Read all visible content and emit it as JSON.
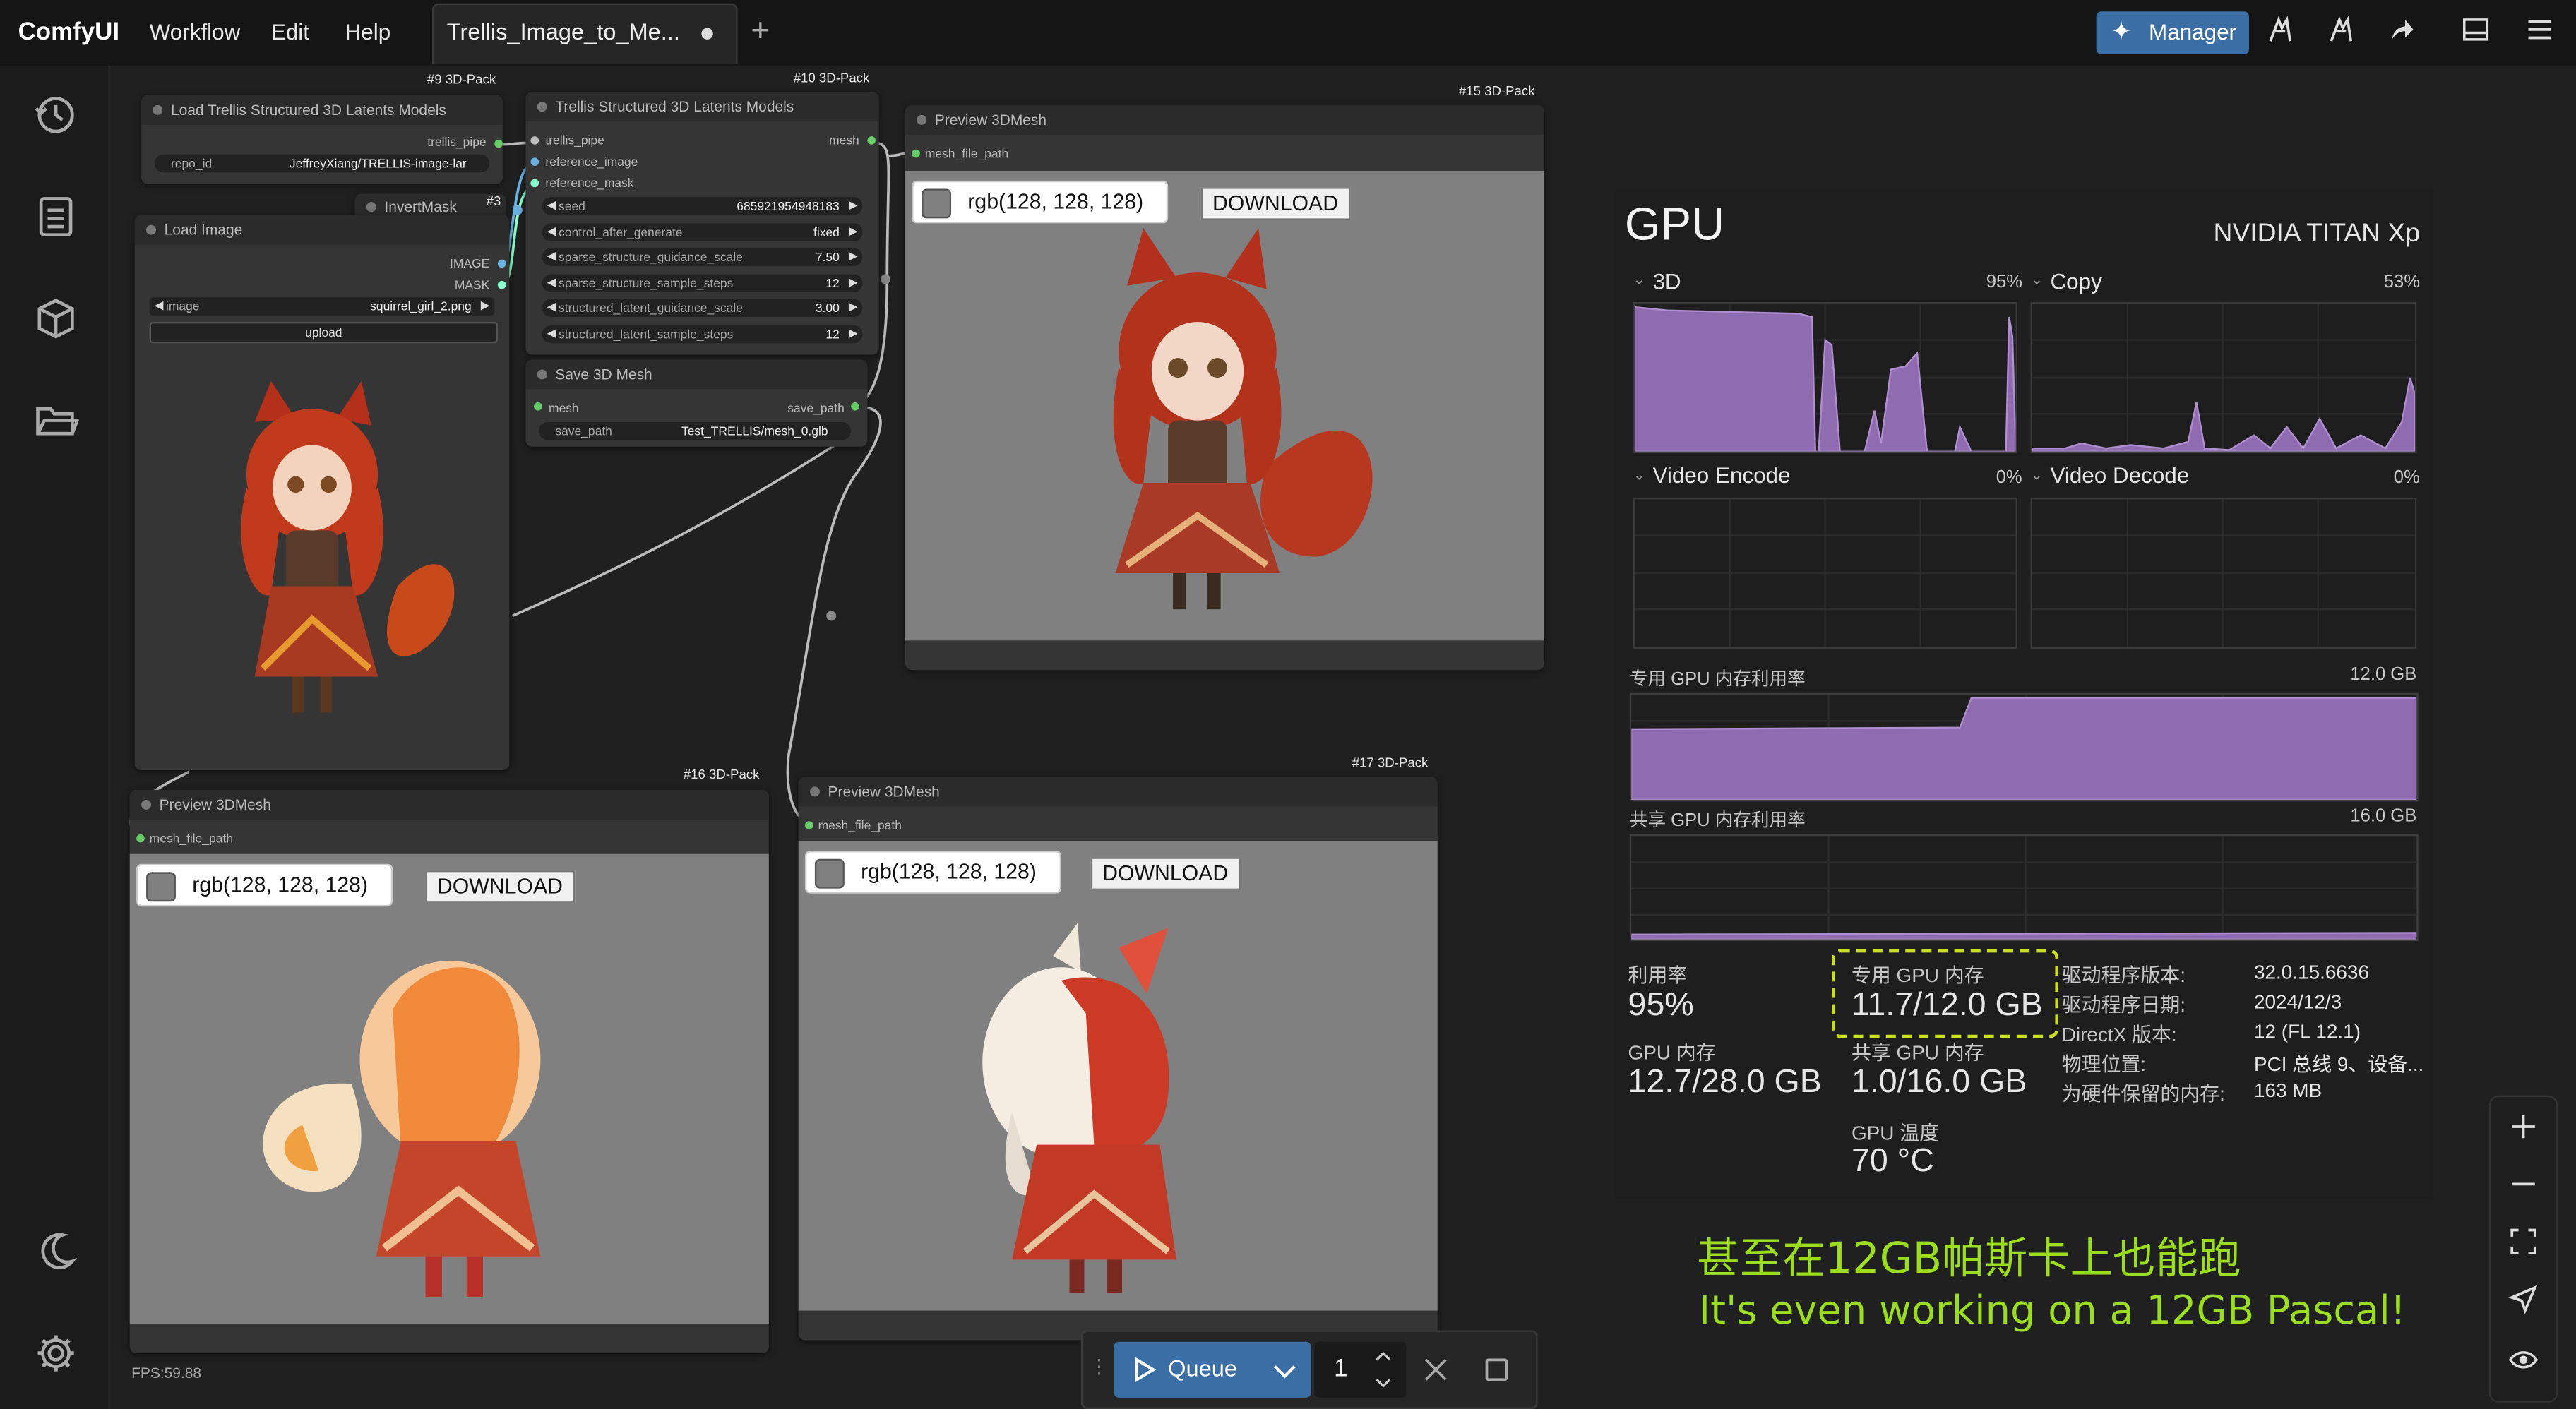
{
  "app": {
    "name": "ComfyUI"
  },
  "menu": [
    "Workflow",
    "Edit",
    "Help"
  ],
  "tab": {
    "title": "Trellis_Image_to_Me..."
  },
  "manager": {
    "label": "Manager"
  },
  "nodes": {
    "load_latents": {
      "badge": "#9 3D-Pack",
      "title": "Load Trellis Structured 3D Latents Models",
      "out": "trellis_pipe",
      "w_label": "repo_id",
      "w_value": "JeffreyXiang/TRELLIS-image-lar"
    },
    "invert_mask": {
      "title": "InvertMask",
      "badge": "#3"
    },
    "load_image": {
      "title": "Load Image",
      "out1": "IMAGE",
      "out2": "MASK",
      "w_label": "image",
      "w_value": "squirrel_girl_2.png",
      "upload": "upload"
    },
    "trellis": {
      "badge": "#10 3D-Pack",
      "title": "Trellis Structured 3D Latents Models",
      "in1": "trellis_pipe",
      "in2": "reference_image",
      "in3": "reference_mask",
      "out": "mesh",
      "widgets": [
        {
          "label": "seed",
          "value": "685921954948183"
        },
        {
          "label": "control_after_generate",
          "value": "fixed"
        },
        {
          "label": "sparse_structure_guidance_scale",
          "value": "7.50"
        },
        {
          "label": "sparse_structure_sample_steps",
          "value": "12"
        },
        {
          "label": "structured_latent_guidance_scale",
          "value": "3.00"
        },
        {
          "label": "structured_latent_sample_steps",
          "value": "12"
        }
      ]
    },
    "save_mesh": {
      "title": "Save 3D Mesh",
      "in": "mesh",
      "out": "save_path",
      "w_label": "save_path",
      "w_value": "Test_TRELLIS/mesh_0.glb"
    },
    "preview15": {
      "badge": "#15 3D-Pack",
      "title": "Preview 3DMesh",
      "in": "mesh_file_path",
      "rgb": "rgb(128, 128, 128)",
      "download": "DOWNLOAD"
    },
    "preview16": {
      "badge": "#16 3D-Pack",
      "title": "Preview 3DMesh",
      "in": "mesh_file_path",
      "rgb": "rgb(128, 128, 128)",
      "download": "DOWNLOAD"
    },
    "preview17": {
      "badge": "#17 3D-Pack",
      "title": "Preview 3DMesh",
      "in": "mesh_file_path",
      "rgb": "rgb(128, 128, 128)",
      "download": "DOWNLOAD"
    }
  },
  "gpu": {
    "title": "GPU",
    "model": "NVIDIA TITAN Xp",
    "g3d": {
      "label": "3D",
      "pct": "95%"
    },
    "gcopy": {
      "label": "Copy",
      "pct": "53%"
    },
    "gvenc": {
      "label": "Video Encode",
      "pct": "0%"
    },
    "gvdec": {
      "label": "Video Decode",
      "pct": "0%"
    },
    "ded_label": "专用 GPU 内存利用率",
    "ded_max": "12.0 GB",
    "shared_label": "共享 GPU 内存利用率",
    "shared_max": "16.0 GB",
    "stats": {
      "util_label": "利用率",
      "util_val": "95%",
      "ded_mem_label": "专用 GPU 内存",
      "ded_mem_val": "11.7/12.0 GB",
      "gpu_mem_label": "GPU 内存",
      "gpu_mem_val": "12.7/28.0 GB",
      "shared_mem_label": "共享 GPU 内存",
      "shared_mem_val": "1.0/16.0 GB",
      "temp_label": "GPU 温度",
      "temp_val": "70 °C"
    },
    "info": [
      {
        "k": "驱动程序版本:",
        "v": "32.0.15.6636"
      },
      {
        "k": "驱动程序日期:",
        "v": "2024/12/3"
      },
      {
        "k": "DirectX 版本:",
        "v": "12 (FL 12.1)"
      },
      {
        "k": "物理位置:",
        "v": "PCI 总线 9、设备..."
      },
      {
        "k": "为硬件保留的内存:",
        "v": "163 MB"
      }
    ]
  },
  "queue": {
    "label": "Queue",
    "count": "1"
  },
  "fps": "FPS:59.88",
  "overlay": {
    "cn": "甚至在12GB帕斯卡上也能跑",
    "en": "It's even working on a 12GB Pascal!"
  },
  "colors": {
    "accent": "#3b6ea5",
    "overlay": "#9bde1e",
    "graph": "#8f6bb0"
  }
}
